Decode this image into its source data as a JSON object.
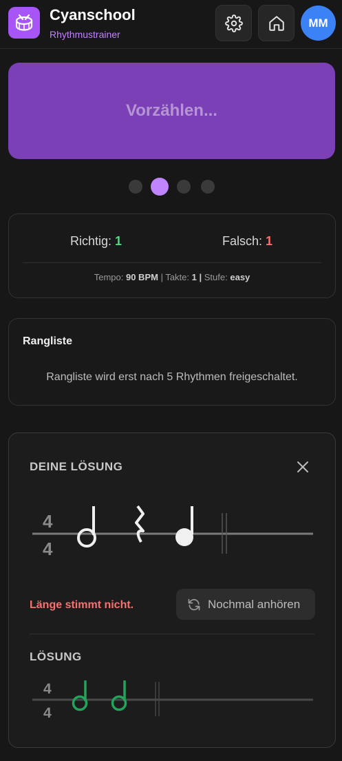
{
  "header": {
    "title": "Cyanschool",
    "subtitle": "Rhythmustrainer",
    "avatar_initials": "MM"
  },
  "count_in_label": "Vorzählen...",
  "progress": {
    "total_dots": 4,
    "active_index": 1
  },
  "stats": {
    "correct_label": "Richtig:",
    "correct_value": "1",
    "wrong_label": "Falsch:",
    "wrong_value": "1",
    "tempo_label": "Tempo:",
    "tempo_value": "90 BPM",
    "bars_label": "Takte:",
    "bars_value": "1",
    "level_label": "Stufe:",
    "level_value": "easy"
  },
  "leaderboard": {
    "title": "Rangliste",
    "message": "Rangliste wird erst nach 5 Rhythmen freigeschaltet."
  },
  "your_solution": {
    "title": "DEINE LÖSUNG",
    "time_signature": [
      "4",
      "4"
    ],
    "notes": [
      "half-note",
      "quarter-rest",
      "quarter-note"
    ],
    "error_message": "Länge stimmt nicht.",
    "replay_label": "Nochmal anhören"
  },
  "solution": {
    "title": "LÖSUNG",
    "time_signature": [
      "4",
      "4"
    ],
    "notes": [
      "half-note",
      "half-note"
    ]
  },
  "colors": {
    "accent": "#a855f7",
    "count_button": "#7b3fb6",
    "correct": "#4ade80",
    "wrong": "#f87171",
    "solution_notes": "#22a55a"
  },
  "icons": [
    "drum-icon",
    "gear-icon",
    "home-icon",
    "close-icon",
    "refresh-icon"
  ]
}
